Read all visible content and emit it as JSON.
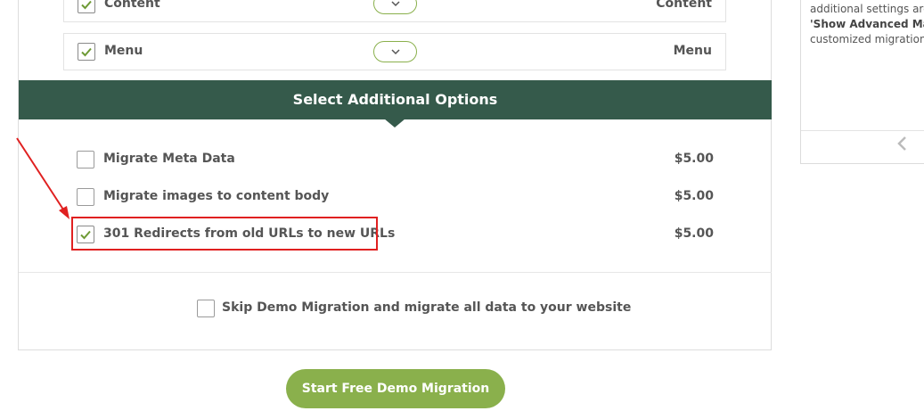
{
  "mapping_rows": [
    {
      "label": "Content",
      "target": "Content",
      "checked": true
    },
    {
      "label": "Menu",
      "target": "Menu",
      "checked": true
    }
  ],
  "additional": {
    "title": "Select Additional Options",
    "options": [
      {
        "label": "Migrate Meta Data",
        "price": "$5.00",
        "checked": false
      },
      {
        "label": "Migrate images to content body",
        "price": "$5.00",
        "checked": false
      },
      {
        "label": "301 Redirects from old URLs to new URLs",
        "price": "$5.00",
        "checked": true
      }
    ]
  },
  "skip": {
    "label": "Skip Demo Migration and migrate all data to your website",
    "checked": false
  },
  "start_button": {
    "label": "Start Free Demo Migration"
  },
  "sidebar": {
    "line1": "additional settings are",
    "line2": "'Show Advanced Map",
    "line3": "customized migration"
  },
  "colors": {
    "band": "#355a4b",
    "accent": "#8ab04c",
    "highlight": "#e02020"
  },
  "icons": {
    "check": "check-icon",
    "dropdown": "chevron-down-icon",
    "sidebar_nav": "chevron-left-icon"
  }
}
